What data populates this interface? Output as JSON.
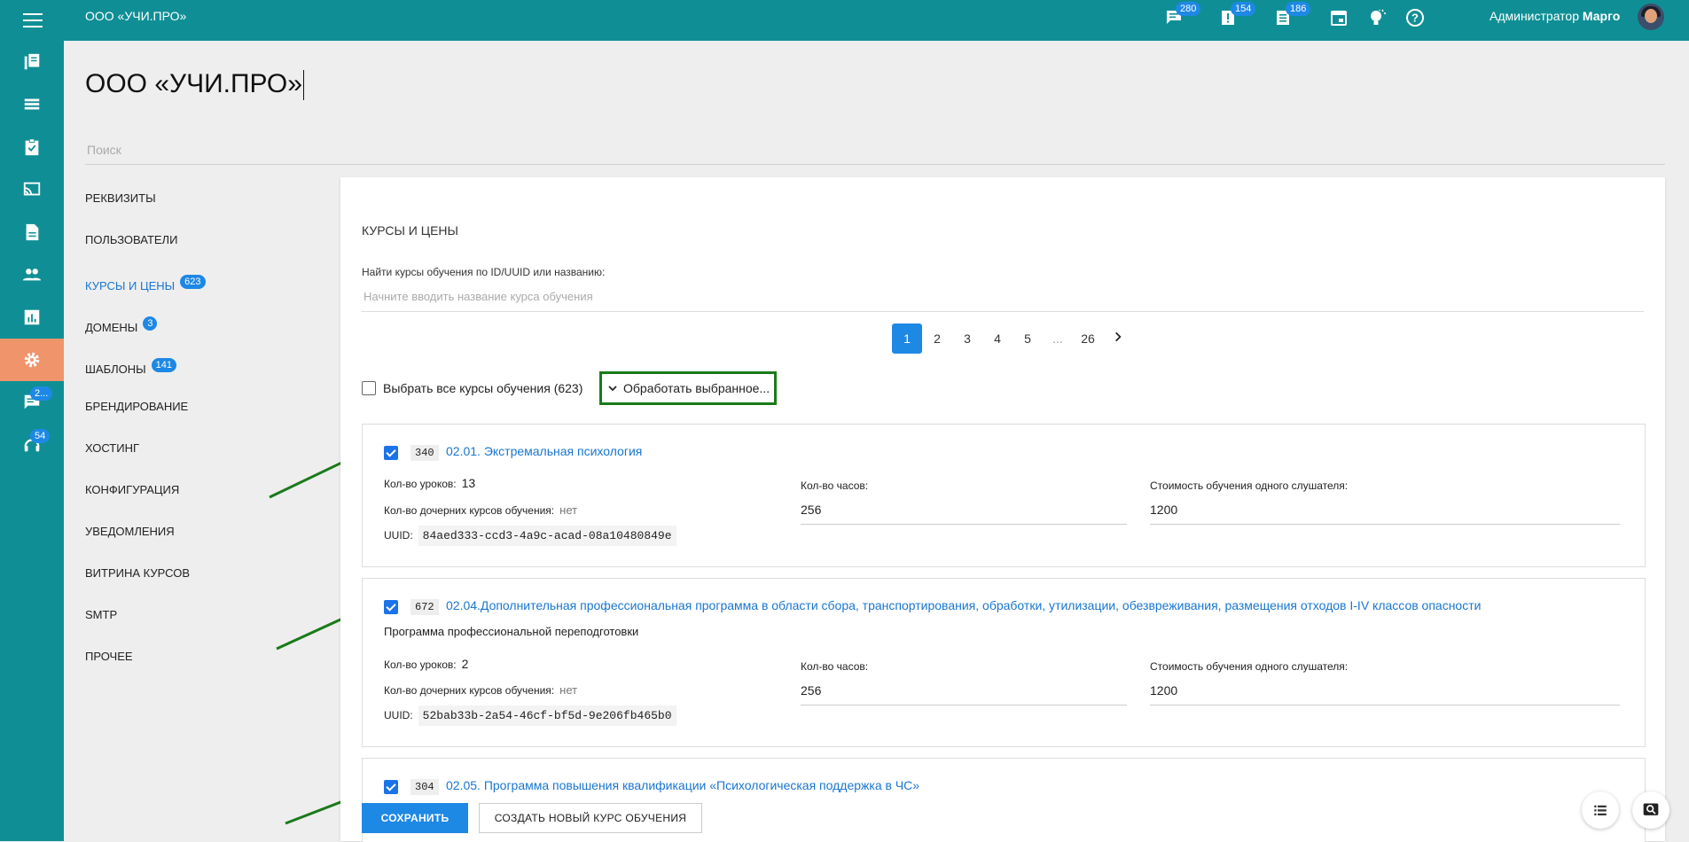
{
  "topbar": {
    "org_name": "ООО «УЧИ.ПРО»",
    "notifications": [
      {
        "icon": "messages-icon",
        "count": "280"
      },
      {
        "icon": "alerts-icon",
        "count": "154"
      },
      {
        "icon": "list-icon",
        "count": "186"
      },
      {
        "icon": "calendar-icon",
        "count": ""
      },
      {
        "icon": "lightbulb-icon",
        "count": ""
      },
      {
        "icon": "help-icon",
        "count": ""
      }
    ],
    "user_role": "Администратор",
    "user_name": "Марго"
  },
  "sidebar": {
    "items": [
      {
        "icon": "book-icon",
        "badge": ""
      },
      {
        "icon": "list-icon",
        "badge": ""
      },
      {
        "icon": "clipboard-icon",
        "badge": ""
      },
      {
        "icon": "cast-icon",
        "badge": ""
      },
      {
        "icon": "document-icon",
        "badge": ""
      },
      {
        "icon": "people-icon",
        "badge": ""
      },
      {
        "icon": "chart-icon",
        "badge": ""
      },
      {
        "icon": "gear-icon",
        "badge": "",
        "active": true
      },
      {
        "icon": "chat-icon",
        "badge": "2..."
      },
      {
        "icon": "support-icon",
        "badge": "54"
      }
    ]
  },
  "page": {
    "title": "ООО «УЧИ.ПРО»",
    "search_placeholder": "Поиск"
  },
  "left_nav": [
    {
      "label": "РЕКВИЗИТЫ",
      "badge": ""
    },
    {
      "label": "ПОЛЬЗОВАТЕЛИ",
      "badge": ""
    },
    {
      "label": "КУРСЫ И ЦЕНЫ",
      "badge": "623",
      "active": true
    },
    {
      "label": "ДОМЕНЫ",
      "badge": "3"
    },
    {
      "label": "ШАБЛОНЫ",
      "badge": "141"
    },
    {
      "label": "БРЕНДИРОВАНИЕ",
      "badge": ""
    },
    {
      "label": "ХОСТИНГ",
      "badge": ""
    },
    {
      "label": "КОНФИГУРАЦИЯ",
      "badge": ""
    },
    {
      "label": "УВЕДОМЛЕНИЯ",
      "badge": ""
    },
    {
      "label": "ВИТРИНА КУРСОВ",
      "badge": ""
    },
    {
      "label": "SMTP",
      "badge": ""
    },
    {
      "label": "ПРОЧЕЕ",
      "badge": ""
    }
  ],
  "panel": {
    "title": "КУРСЫ И ЦЕНЫ",
    "search_label": "Найти курсы обучения по ID/UUID или названию:",
    "search_placeholder": "Начните вводить название курса обучения",
    "pages": [
      "1",
      "2",
      "3",
      "4",
      "5",
      "...",
      "26"
    ],
    "current_page": "1",
    "select_all_label": "Выбрать все курсы обучения (623)",
    "process_label": "Обработать выбранное...",
    "lessons_label": "Кол-во уроков:",
    "children_label": "Кол-во дочерних курсов обучения:",
    "uuid_label": "UUID:",
    "hours_label": "Кол-во часов:",
    "price_label": "Стоимость обучения одного слушателя:",
    "save_label": "СОХРАНИТЬ",
    "create_label": "СОЗДАТЬ НОВЫЙ КУРС ОБУЧЕНИЯ"
  },
  "courses": [
    {
      "id": "340",
      "name": "02.01. Экстремальная психология",
      "subtitle": "",
      "lessons": "13",
      "children": "нет",
      "uuid": "84aed333-ccd3-4a9c-acad-08a10480849e",
      "hours": "256",
      "price": "1200",
      "checked": true
    },
    {
      "id": "672",
      "name": "02.04.Дополнительная профессиональная программа в области сбора, транспортирования, обработки, утилизации, обезвреживания, размещения отходов I-IV классов опасности",
      "subtitle": "Программа профессиональной переподготовки",
      "lessons": "2",
      "children": "нет",
      "uuid": "52bab33b-2a54-46cf-bf5d-9e206fb465b0",
      "hours": "256",
      "price": "1200",
      "checked": true
    },
    {
      "id": "304",
      "name": "02.05. Программа повышения квалификации «Психологическая поддержка в ЧС»",
      "subtitle": "",
      "checked": true
    }
  ],
  "colors": {
    "topbar": "#0f8f95",
    "accent": "#1e88e5",
    "active_sidebar": "#f0946b",
    "highlight_box": "#1a7a1a",
    "annotation_arrow": "#1a7a1a"
  }
}
